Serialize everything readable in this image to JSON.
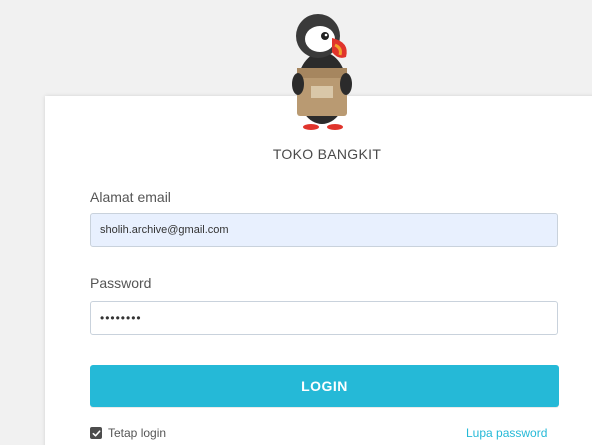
{
  "shop": {
    "name": "TOKO BANGKIT"
  },
  "form": {
    "email_label": "Alamat email",
    "email_value": "sholih.archive@gmail.com",
    "password_label": "Password",
    "password_value": "••••••••",
    "login_label": "LOGIN",
    "remember_label": "Tetap login",
    "remember_checked": true,
    "forgot_label": "Lupa password"
  },
  "colors": {
    "accent": "#25b9d7",
    "autofill": "#e8f0fe"
  },
  "icons": {
    "logo": "puffin-mascot-icon",
    "checkbox": "checkmark-icon"
  }
}
